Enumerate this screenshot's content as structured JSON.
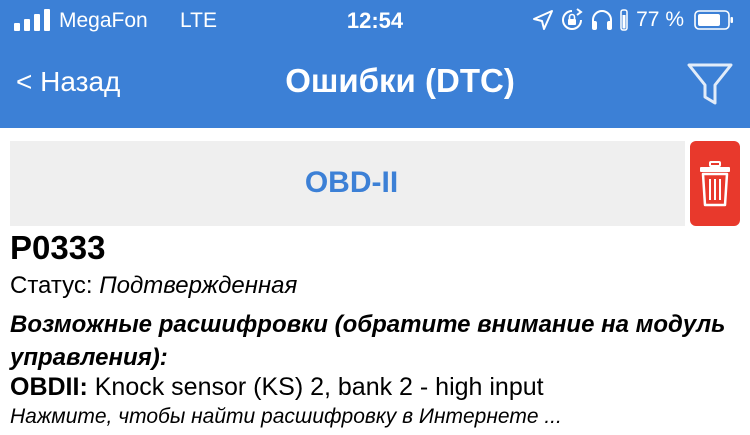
{
  "status_bar": {
    "carrier": "MegaFon",
    "network": "LTE",
    "time": "12:54",
    "battery_percent": "77 %",
    "icons": [
      "signal-icon",
      "location-arrow-icon",
      "rotation-lock-icon",
      "headphones-icon",
      "battery-icon"
    ]
  },
  "nav": {
    "back_label": "< Назад",
    "title": "Ошибки (DTC)",
    "filter_icon": "filter-icon"
  },
  "section": {
    "label": "OBD-II",
    "delete_icon": "trash-icon"
  },
  "dtc": {
    "code": "P0333",
    "status_label": "Статус:",
    "status_value": "Подтвержденная",
    "decodings_heading": "Возможные расшифровки (обратите внимание на модуль управления):",
    "decoding_module": "OBDII:",
    "decoding_text": "Knock sensor (KS) 2, bank 2 - high input",
    "search_hint": "Нажмите, чтобы найти расшифровку в Интернете ..."
  },
  "colors": {
    "header_bg": "#3c80d6",
    "accent": "#3c80d6",
    "delete_bg": "#e8392c",
    "section_bg": "#efefef"
  }
}
